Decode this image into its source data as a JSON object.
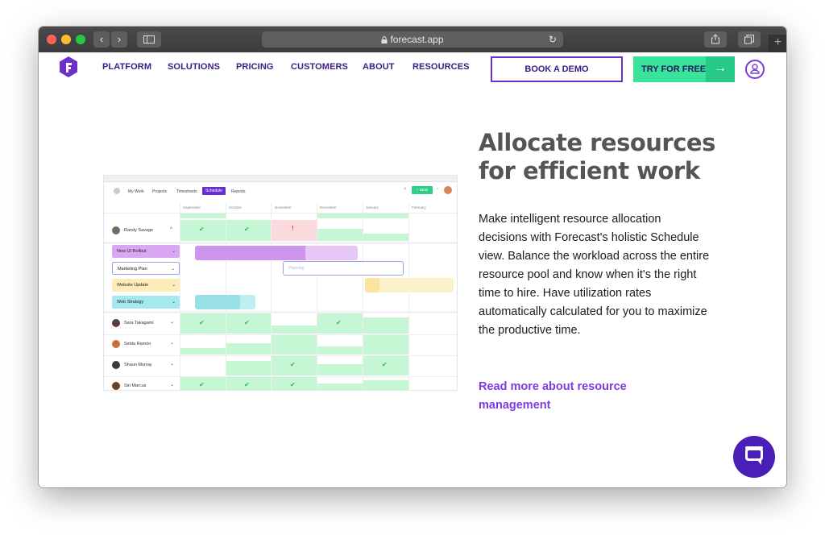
{
  "browser": {
    "url": "forecast.app",
    "sidebar_glyph": "sidebar-icon",
    "back_glyph": "‹",
    "forward_glyph": "›",
    "share_glyph": "share-icon",
    "tabs_glyph": "tabs-icon",
    "new_tab_glyph": "+"
  },
  "nav": {
    "items": [
      "PLATFORM",
      "SOLUTIONS",
      "PRICING",
      "CUSTOMERS",
      "ABOUT",
      "RESOURCES"
    ],
    "demo_label": "BOOK A DEMO",
    "try_label": "TRY FOR FREE",
    "try_arrow": "→"
  },
  "hero": {
    "headline": "Allocate resources for efficient work",
    "body": "Make intelligent resource allocation decisions with Forecast's holistic Schedule view. Balance the workload across the entire resource pool and know when it's the right time to hire. Have utilization rates automatically calculated for you to maximize the productive time.",
    "read_more": "Read more about resource management"
  },
  "app": {
    "tabs": [
      "My Work",
      "Projects",
      "Timesheets",
      "Schedule",
      "Reports"
    ],
    "active_tab": "Schedule",
    "new_label": "+ NEW",
    "months": [
      "September",
      "October",
      "November",
      "December",
      "January",
      "February"
    ],
    "people": [
      {
        "name": "Randy Savage",
        "expanded": true
      },
      {
        "name": "Sara Takagami"
      },
      {
        "name": "Selda Ramón"
      },
      {
        "name": "Shaun Murray"
      },
      {
        "name": "Siri Marcus"
      }
    ],
    "projects": [
      {
        "name": "New UI Rollout",
        "color": "#d9a6f2"
      },
      {
        "name": "Marketing Plan",
        "color": "#ffffff"
      },
      {
        "name": "Website Update",
        "color": "#fcecb8"
      },
      {
        "name": "Web Strategy",
        "color": "#a5e8ee"
      }
    ],
    "planning_label": "Planning",
    "warning_glyph": "!"
  },
  "colors": {
    "brand_purple": "#6a30c8",
    "navy": "#3b1d86",
    "green": "#3ae39b",
    "headline_gray": "#555558",
    "link_purple": "#7e3be1"
  }
}
